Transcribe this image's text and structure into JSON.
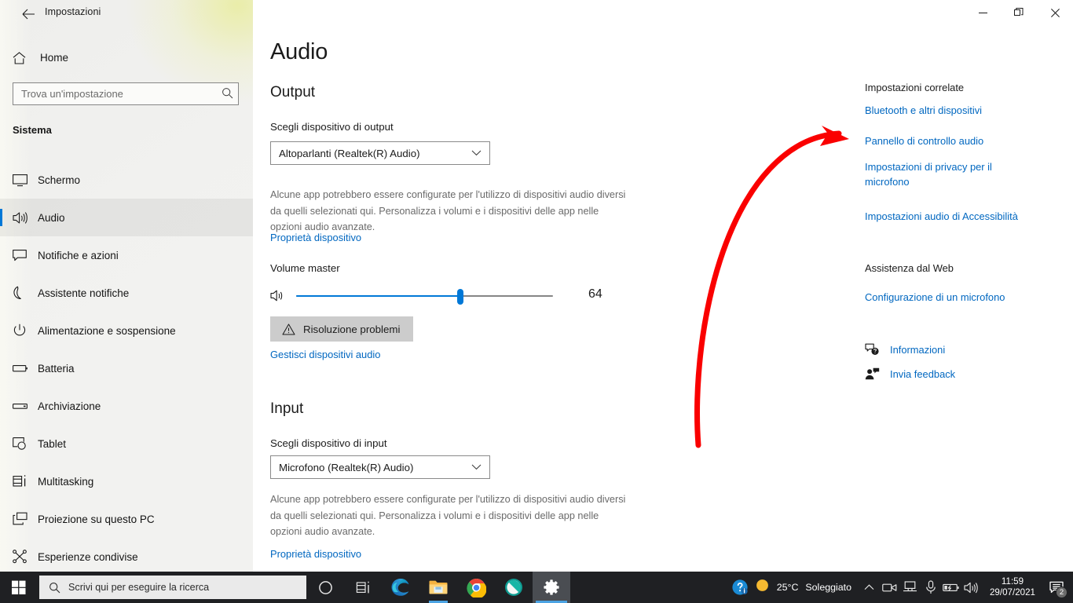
{
  "window": {
    "title": "Impostazioni",
    "back_icon": "back-arrow-icon",
    "minimize_label": "Riduci a icona",
    "restore_label": "Ripristina",
    "close_label": "Chiudi"
  },
  "nav": {
    "home_label": "Home",
    "home_icon": "home-icon",
    "search": {
      "placeholder": "Trova un'impostazione",
      "value": "",
      "icon": "search-icon"
    },
    "group_title": "Sistema",
    "items": [
      {
        "label": "Schermo",
        "icon": "monitor-icon",
        "selected": false
      },
      {
        "label": "Audio",
        "icon": "speaker-icon",
        "selected": true
      },
      {
        "label": "Notifiche e azioni",
        "icon": "notification-icon",
        "selected": false
      },
      {
        "label": "Assistente notifiche",
        "icon": "moon-icon",
        "selected": false
      },
      {
        "label": "Alimentazione e sospensione",
        "icon": "power-icon",
        "selected": false
      },
      {
        "label": "Batteria",
        "icon": "battery-icon",
        "selected": false
      },
      {
        "label": "Archiviazione",
        "icon": "storage-icon",
        "selected": false
      },
      {
        "label": "Tablet",
        "icon": "tablet-icon",
        "selected": false
      },
      {
        "label": "Multitasking",
        "icon": "multitasking-icon",
        "selected": false
      },
      {
        "label": "Proiezione su questo PC",
        "icon": "projection-icon",
        "selected": false
      },
      {
        "label": "Esperienze condivise",
        "icon": "shared-experiences-icon",
        "selected": false
      }
    ]
  },
  "main": {
    "page_title": "Audio",
    "output": {
      "section_title": "Output",
      "device_label": "Scegli dispositivo di output",
      "device_value": "Altoparlanti (Realtek(R) Audio)",
      "helper_text": "Alcune app potrebbero essere configurate per l'utilizzo di dispositivi audio diversi da quelli selezionati qui. Personalizza i volumi e i dispositivi delle app nelle opzioni audio avanzate.",
      "device_properties_link": "Proprietà dispositivo",
      "volume_label": "Volume master",
      "volume_value": 64,
      "volume_min": 0,
      "volume_max": 100,
      "speaker_icon": "speaker-icon",
      "troubleshoot_label": "Risoluzione problemi",
      "troubleshoot_icon": "warning-triangle-icon",
      "manage_devices_link": "Gestisci dispositivi audio"
    },
    "input": {
      "section_title": "Input",
      "device_label": "Scegli dispositivo di input",
      "device_value": "Microfono (Realtek(R) Audio)",
      "helper_text": "Alcune app potrebbero essere configurate per l'utilizzo di dispositivi audio diversi da quelli selezionati qui. Personalizza i volumi e i dispositivi delle app nelle opzioni audio avanzate.",
      "device_properties_link": "Proprietà dispositivo"
    }
  },
  "aside": {
    "related_heading": "Impostazioni correlate",
    "related_links": [
      "Bluetooth e altri dispositivi",
      "Pannello di controllo audio",
      "Impostazioni di privacy per il microfono",
      "Impostazioni audio di Accessibilità"
    ],
    "web_heading": "Assistenza dal Web",
    "web_links": [
      "Configurazione di un microfono"
    ],
    "footer_links": [
      {
        "label": "Informazioni",
        "icon": "help-bubble-icon"
      },
      {
        "label": "Invia feedback",
        "icon": "feedback-person-icon"
      }
    ]
  },
  "annotation": {
    "type": "curved-arrow",
    "color": "#fa0000",
    "points_to": "Pannello di controllo audio"
  },
  "taskbar": {
    "start_icon": "windows-start-icon",
    "search": {
      "placeholder": "Scrivi qui per eseguire la ricerca",
      "icon": "search-icon"
    },
    "items": [
      {
        "name": "cortana-icon",
        "active": false,
        "underline": "none"
      },
      {
        "name": "task-view-icon",
        "active": false,
        "underline": "none"
      },
      {
        "name": "microsoft-edge-icon",
        "active": false,
        "underline": "none"
      },
      {
        "name": "file-explorer-icon",
        "active": false,
        "underline": "short"
      },
      {
        "name": "google-chrome-icon",
        "active": false,
        "underline": "none"
      },
      {
        "name": "teal-app-icon",
        "active": false,
        "underline": "none"
      },
      {
        "name": "settings-gear-icon",
        "active": true,
        "underline": "full"
      }
    ],
    "tray": {
      "help_icon": "help-circle-icon",
      "weather": {
        "icon": "sun-icon",
        "temperature": "25°C",
        "condition": "Soleggiato"
      },
      "overflow_icon": "chevron-up-icon",
      "icons": [
        "meet-now-icon",
        "network-icon",
        "microphone-icon",
        "battery-charging-icon",
        "volume-icon"
      ],
      "clock": {
        "time": "11:59",
        "date": "29/07/2021"
      },
      "notifications": {
        "icon": "action-center-icon",
        "count": "2"
      }
    }
  },
  "colors": {
    "accent": "#0078d7",
    "link": "#0067c0",
    "annotation": "#fa0000",
    "taskbar_bg": "#1f2023",
    "nav_bg": "#f2f2f0"
  }
}
